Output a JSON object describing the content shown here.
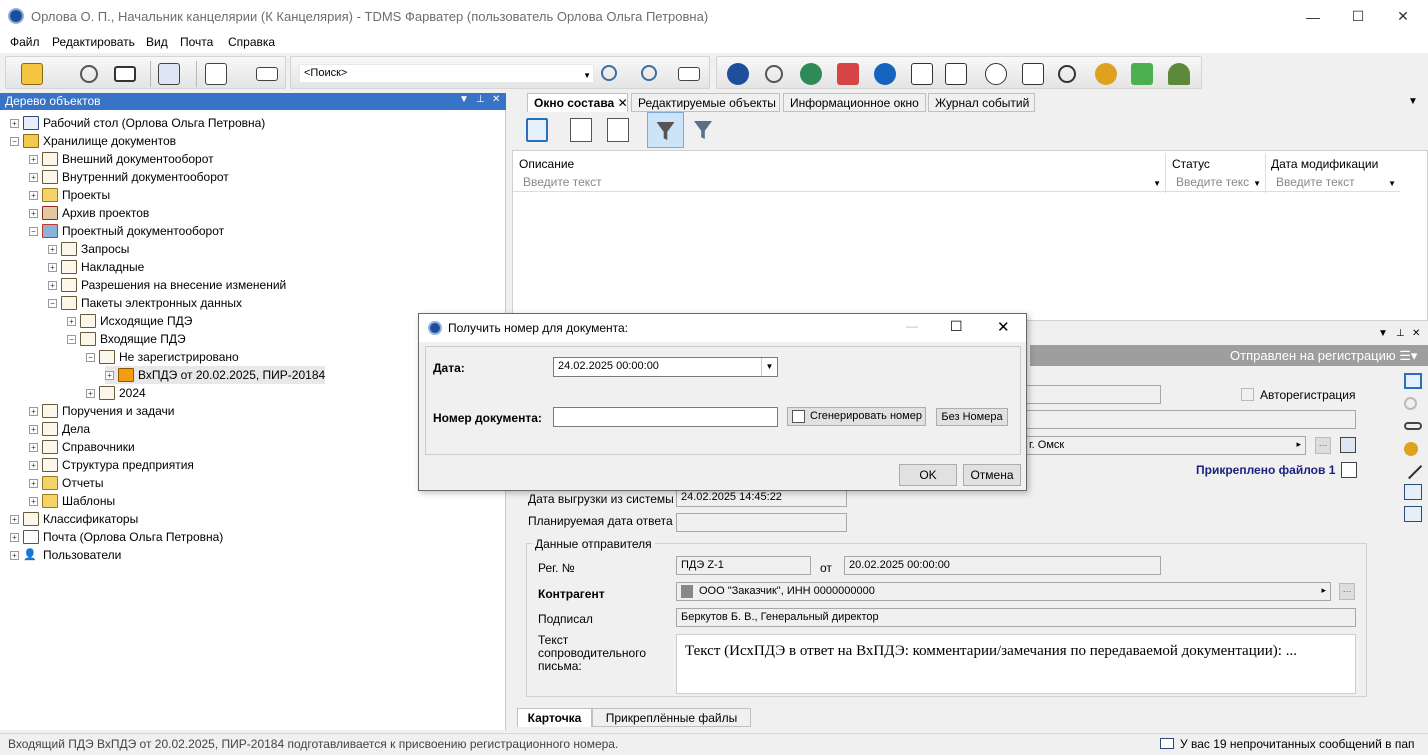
{
  "window": {
    "title": "Орлова О. П., Начальник канцелярии (К Канцелярия) - TDMS Фарватер (пользователь Орлова Ольга Петровна)",
    "minimize": "—",
    "maximize": "☐",
    "close": "✕"
  },
  "menu": [
    "Файл",
    "Редактировать",
    "Вид",
    "Почта",
    "Справка"
  ],
  "toolbar": {
    "search_placeholder": "<Поиск>"
  },
  "tree": {
    "header": "Дерево объектов",
    "nodes": [
      {
        "label": "Рабочий стол (Орлова Ольга Петровна)",
        "icon": "desk-icon",
        "exp": "+"
      },
      {
        "label": "Хранилище документов",
        "icon": "storage-icon",
        "exp": "−"
      },
      {
        "label": "Внешний документооборот",
        "icon": "folder-icon",
        "exp": "+"
      },
      {
        "label": "Внутренний документооборот",
        "icon": "folder-icon",
        "exp": "+"
      },
      {
        "label": "Проекты",
        "icon": "projects-icon",
        "exp": "+"
      },
      {
        "label": "Архив проектов",
        "icon": "archive-icon",
        "exp": "+"
      },
      {
        "label": "Проектный документооборот",
        "icon": "project-docflow-icon",
        "exp": "−"
      },
      {
        "label": "Запросы",
        "icon": "folder-icon",
        "exp": "+"
      },
      {
        "label": "Накладные",
        "icon": "folder-icon",
        "exp": "+"
      },
      {
        "label": "Разрешения на внесение изменений",
        "icon": "folder-icon",
        "exp": "+"
      },
      {
        "label": "Пакеты электронных данных",
        "icon": "folder-icon",
        "exp": "−"
      },
      {
        "label": "Исходящие ПДЭ",
        "icon": "folder-icon",
        "exp": "+"
      },
      {
        "label": "Входящие ПДЭ",
        "icon": "folder-icon",
        "exp": "−"
      },
      {
        "label": "Не зарегистрировано",
        "icon": "folder-icon",
        "exp": "−"
      },
      {
        "label": "ВхПДЭ от 20.02.2025, ПИР-20184",
        "icon": "incoming-package-icon",
        "exp": "+"
      },
      {
        "label": "2024",
        "icon": "folder-icon",
        "exp": "+"
      },
      {
        "label": "Поручения и задачи",
        "icon": "folder-icon",
        "exp": "+"
      },
      {
        "label": "Дела",
        "icon": "folder-icon",
        "exp": "+"
      },
      {
        "label": "Справочники",
        "icon": "folder-icon",
        "exp": "+"
      },
      {
        "label": "Структура предприятия",
        "icon": "org-structure-icon",
        "exp": "+"
      },
      {
        "label": "Отчеты",
        "icon": "reports-icon",
        "exp": "+"
      },
      {
        "label": "Шаблоны",
        "icon": "templates-icon",
        "exp": "+"
      },
      {
        "label": "Классификаторы",
        "icon": "classifiers-icon",
        "exp": "+"
      },
      {
        "label": "Почта (Орлова Ольга Петровна)",
        "icon": "mail-icon",
        "exp": "+"
      },
      {
        "label": "Пользователи",
        "icon": "users-icon",
        "exp": "+"
      }
    ]
  },
  "tabs": [
    "Окно состава",
    "Редактируемые объекты",
    "Информационное окно",
    "Журнал событий"
  ],
  "grid": {
    "columns": [
      "Описание",
      "Статус",
      "Дата модификации"
    ],
    "filter_placeholder": "Введите текст",
    "filter_placeholder_short": "Введите текс"
  },
  "card": {
    "status": "Отправлен на регистрацию",
    "autoreg_label": "Авторегистрация",
    "city": "г. Омск",
    "attached_files": "Прикреплено файлов 1",
    "export_date_label": "Дата выгрузки из системы",
    "export_date": "24.02.2025 14:45:22",
    "planned_answer_label": "Планируемая дата ответа",
    "sender_group": "Данные отправителя",
    "reg_no_label": "Рег. №",
    "reg_no": "ПДЭ Z-1",
    "from_label": "от",
    "from_date": "20.02.2025 00:00:00",
    "counterparty_label": "Контрагент",
    "counterparty": "ООО \"Заказчик\", ИНН 0000000000",
    "signed_label": "Подписал",
    "signed": "Беркутов Б. В., Генеральный директор",
    "cover_letter_label": "Текст сопроводительного письма:",
    "cover_letter": "Текст (ИсхПДЭ в ответ на ВхПДЭ: комментарии/замечания по передаваемой документации): ..."
  },
  "bottom_tabs": [
    "Карточка",
    "Прикреплённые файлы"
  ],
  "status": {
    "left": "Входящий ПДЭ ВхПДЭ от 20.02.2025, ПИР-20184 подготавливается к присвоению регистрационного номера.",
    "right": "У вас 19 непрочитанных сообщений в пап"
  },
  "dialog": {
    "title": "Получить номер для документа:",
    "date_label": "Дата:",
    "date_value": "24.02.2025 00:00:00",
    "number_label": "Номер документа:",
    "number_value": "",
    "generate": "Сгенерировать номер",
    "no_number": "Без Номера",
    "ok": "OK",
    "cancel": "Отмена"
  }
}
